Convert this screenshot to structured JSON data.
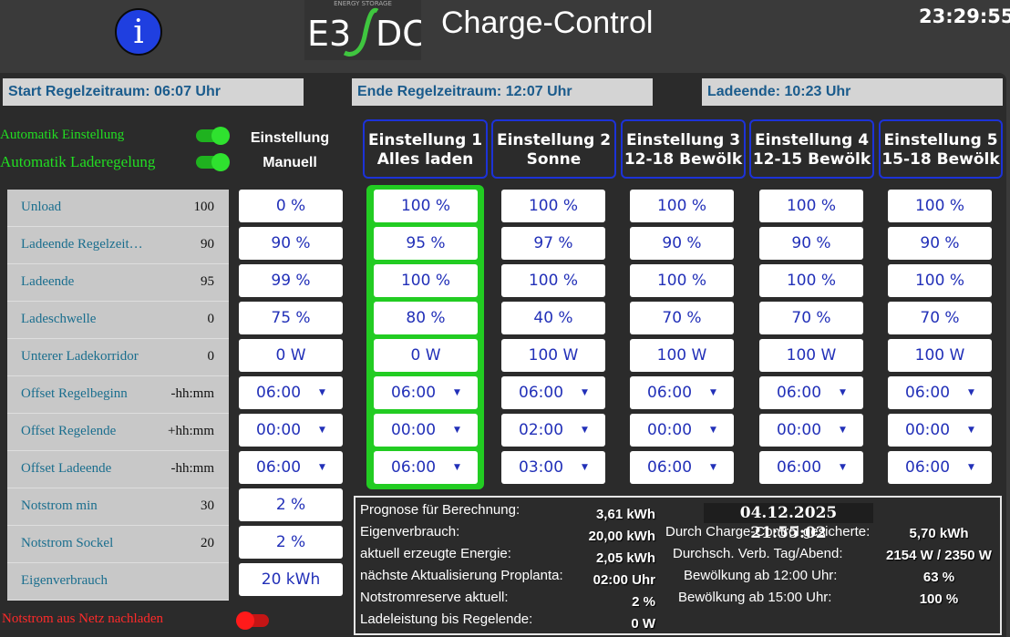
{
  "header": {
    "info_icon": "i",
    "logo_text_left": "E3",
    "logo_text_right": "DC",
    "logo_subtitle": "ENERGY STORAGE",
    "title": "Charge-Control",
    "clock": "23:29:55"
  },
  "ranges": {
    "start": "Start Regelzeitraum: 06:07 Uhr",
    "end": "Ende Regelzeitraum: 12:07 Uhr",
    "ladeende": "Ladeende: 10:23 Uhr"
  },
  "auto": {
    "einstellung_label": "Automatik Einstellung",
    "laderegelung_label": "Automatik Laderegelung",
    "einstellung_on": true,
    "laderegelung_on": true
  },
  "manual_header": [
    "Einstellung",
    "Manuell"
  ],
  "settings": [
    {
      "line1": "Einstellung 1",
      "line2": "Alles laden"
    },
    {
      "line1": "Einstellung 2",
      "line2": "Sonne"
    },
    {
      "line1": "Einstellung 3",
      "line2": "12-18 Bewölk"
    },
    {
      "line1": "Einstellung 4",
      "line2": "12-15 Bewölk"
    },
    {
      "line1": "Einstellung 5",
      "line2": "15-18 Bewölk"
    }
  ],
  "params": [
    {
      "name": "Unload",
      "value": "100",
      "manual": "0 %",
      "settings": [
        "100 %",
        "100 %",
        "100 %",
        "100 %",
        "100 %"
      ]
    },
    {
      "name": "Ladeende Regelzeit…",
      "value": "90",
      "manual": "90 %",
      "settings": [
        "95 %",
        "97 %",
        "90 %",
        "90 %",
        "90 %"
      ]
    },
    {
      "name": "Ladeende",
      "value": "95",
      "manual": "99 %",
      "settings": [
        "100 %",
        "100 %",
        "100 %",
        "100 %",
        "100 %"
      ]
    },
    {
      "name": "Ladeschwelle",
      "value": "0",
      "manual": "75 %",
      "settings": [
        "80 %",
        "40 %",
        "70 %",
        "70 %",
        "70 %"
      ]
    },
    {
      "name": "Unterer Ladekorridor",
      "value": "0",
      "manual": "0 W",
      "settings": [
        "0 W",
        "100 W",
        "100 W",
        "100 W",
        "100 W"
      ]
    },
    {
      "name": "Offset Regelbeginn",
      "value": "-hh:mm",
      "manual": "06:00",
      "dropdown": true,
      "settings": [
        "06:00",
        "06:00",
        "06:00",
        "06:00",
        "06:00"
      ]
    },
    {
      "name": "Offset Regelende",
      "value": "+hh:mm",
      "manual": "00:00",
      "dropdown": true,
      "settings": [
        "00:00",
        "02:00",
        "00:00",
        "00:00",
        "00:00"
      ]
    },
    {
      "name": "Offset Ladeende",
      "value": "-hh:mm",
      "manual": "06:00",
      "dropdown": true,
      "settings": [
        "06:00",
        "03:00",
        "06:00",
        "06:00",
        "06:00"
      ]
    },
    {
      "name": "Notstrom min",
      "value": "30",
      "manual": "2 %"
    },
    {
      "name": "Notstrom Sockel",
      "value": "20",
      "manual": "2 %"
    },
    {
      "name": "Eigenverbrauch",
      "value": "",
      "manual": "20 kWh"
    }
  ],
  "notstrom_netz": {
    "label": "Notstrom aus Netz nachladen",
    "on": false
  },
  "info": {
    "date": "04.12.2025 21:55:02",
    "left": [
      {
        "label": "Prognose für Berechnung:",
        "value": "3,61 kWh"
      },
      {
        "label": "Eigenverbrauch:",
        "value": "20,00 kWh"
      },
      {
        "label": "aktuell erzeugte Energie:",
        "value": "2,05 kWh"
      },
      {
        "label": "nächste Aktualisierung Proplanta:",
        "value": "02:00 Uhr"
      },
      {
        "label": "Notstromreserve aktuell:",
        "value": "2 %"
      },
      {
        "label": "Ladeleistung bis Regelende:",
        "value": "0 W"
      }
    ],
    "right": [
      {
        "label": "Durch Charge-Control gesicherte:",
        "value": "5,70 kWh"
      },
      {
        "label": "Durchsch. Verb. Tag/Abend:",
        "value": "2154 W / 2350 W"
      },
      {
        "label": "Bewölkung ab 12:00 Uhr:",
        "value": "63 %"
      },
      {
        "label": "Bewölkung ab 15:00 Uhr:",
        "value": "100 %"
      }
    ]
  },
  "colors": {
    "accent_green": "#22cc22",
    "setting_border": "#1c32d8",
    "value_blue": "#2230b8",
    "label_teal": "#1a6e8e"
  }
}
